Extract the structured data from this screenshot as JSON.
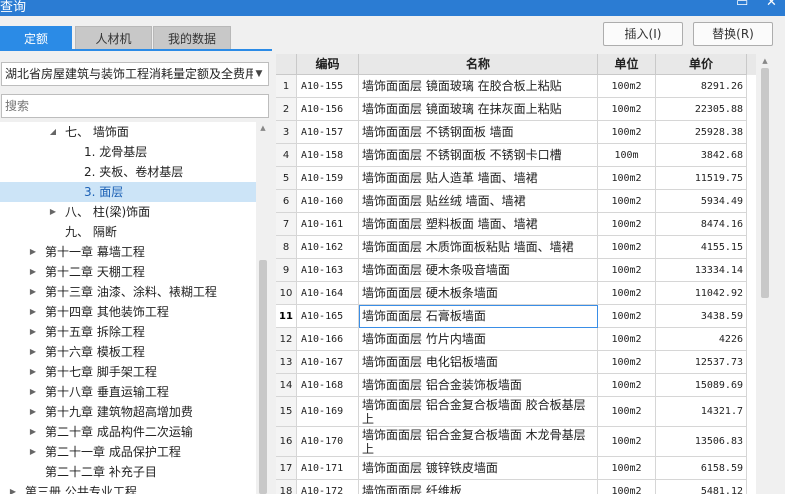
{
  "window": {
    "title": "查询",
    "close_glyph": "✕",
    "restore_glyph": "▭"
  },
  "tabs": [
    {
      "label": "定额",
      "active": true
    },
    {
      "label": "人材机",
      "active": false
    },
    {
      "label": "我的数据",
      "active": false
    }
  ],
  "buttons": {
    "insert": "插入(I)",
    "replace": "替换(R)"
  },
  "library_select": {
    "value": "湖北省房屋建筑与装饰工程消耗量定额及全费用"
  },
  "search": {
    "placeholder": "搜索"
  },
  "tree": [
    {
      "label": "七、 墙饰面",
      "expander": "expanded",
      "level": 2,
      "selected": false
    },
    {
      "label": "1. 龙骨基层",
      "expander": "none",
      "level": 3,
      "selected": false
    },
    {
      "label": "2. 夹板、卷材基层",
      "expander": "none",
      "level": 3,
      "selected": false
    },
    {
      "label": "3. 面层",
      "expander": "none",
      "level": 3,
      "selected": true
    },
    {
      "label": "八、 柱(梁)饰面",
      "expander": "collapsed",
      "level": 2,
      "selected": false
    },
    {
      "label": "九、 隔断",
      "expander": "none",
      "level": 2,
      "selected": false
    },
    {
      "label": "第十一章 幕墙工程",
      "expander": "collapsed",
      "level": 1,
      "selected": false
    },
    {
      "label": "第十二章 天棚工程",
      "expander": "collapsed",
      "level": 1,
      "selected": false
    },
    {
      "label": "第十三章 油漆、涂料、裱糊工程",
      "expander": "collapsed",
      "level": 1,
      "selected": false
    },
    {
      "label": "第十四章 其他装饰工程",
      "expander": "collapsed",
      "level": 1,
      "selected": false
    },
    {
      "label": "第十五章 拆除工程",
      "expander": "collapsed",
      "level": 1,
      "selected": false
    },
    {
      "label": "第十六章 模板工程",
      "expander": "collapsed",
      "level": 1,
      "selected": false
    },
    {
      "label": "第十七章 脚手架工程",
      "expander": "collapsed",
      "level": 1,
      "selected": false
    },
    {
      "label": "第十八章 垂直运输工程",
      "expander": "collapsed",
      "level": 1,
      "selected": false
    },
    {
      "label": "第十九章 建筑物超高增加费",
      "expander": "collapsed",
      "level": 1,
      "selected": false
    },
    {
      "label": "第二十章 成品构件二次运输",
      "expander": "collapsed",
      "level": 1,
      "selected": false
    },
    {
      "label": "第二十一章 成品保护工程",
      "expander": "collapsed",
      "level": 1,
      "selected": false
    },
    {
      "label": "第二十二章 补充子目",
      "expander": "none",
      "level": 1,
      "selected": false
    },
    {
      "label": "第三册 公共专业工程",
      "expander": "collapsed",
      "level": 0,
      "selected": false
    }
  ],
  "table": {
    "columns": [
      "编码",
      "名称",
      "单位",
      "单价"
    ],
    "rows": [
      {
        "num": "1",
        "code": "A10-155",
        "name": "墙饰面面层 镜面玻璃 在胶合板上粘贴",
        "unit": "100m2",
        "price": "8291.26"
      },
      {
        "num": "2",
        "code": "A10-156",
        "name": "墙饰面面层 镜面玻璃 在抹灰面上粘贴",
        "unit": "100m2",
        "price": "22305.88"
      },
      {
        "num": "3",
        "code": "A10-157",
        "name": "墙饰面面层 不锈钢面板 墙面",
        "unit": "100m2",
        "price": "25928.38"
      },
      {
        "num": "4",
        "code": "A10-158",
        "name": "墙饰面面层 不锈钢面板 不锈钢卡口槽",
        "unit": "100m",
        "price": "3842.68"
      },
      {
        "num": "5",
        "code": "A10-159",
        "name": "墙饰面面层 贴人造革 墙面、墙裙",
        "unit": "100m2",
        "price": "11519.75"
      },
      {
        "num": "6",
        "code": "A10-160",
        "name": "墙饰面面层 贴丝绒 墙面、墙裙",
        "unit": "100m2",
        "price": "5934.49"
      },
      {
        "num": "7",
        "code": "A10-161",
        "name": "墙饰面面层 塑料板面 墙面、墙裙",
        "unit": "100m2",
        "price": "8474.16"
      },
      {
        "num": "8",
        "code": "A10-162",
        "name": "墙饰面面层 木质饰面板粘贴 墙面、墙裙",
        "unit": "100m2",
        "price": "4155.15"
      },
      {
        "num": "9",
        "code": "A10-163",
        "name": "墙饰面面层 硬木条吸音墙面",
        "unit": "100m2",
        "price": "13334.14"
      },
      {
        "num": "10",
        "code": "A10-164",
        "name": "墙饰面面层 硬木板条墙面",
        "unit": "100m2",
        "price": "11042.92"
      },
      {
        "num": "11",
        "code": "A10-165",
        "name": "墙饰面面层 石膏板墙面",
        "unit": "100m2",
        "price": "3438.59",
        "current": true
      },
      {
        "num": "12",
        "code": "A10-166",
        "name": "墙饰面面层 竹片内墙面",
        "unit": "100m2",
        "price": "4226"
      },
      {
        "num": "13",
        "code": "A10-167",
        "name": "墙饰面面层 电化铝板墙面",
        "unit": "100m2",
        "price": "12537.73"
      },
      {
        "num": "14",
        "code": "A10-168",
        "name": "墙饰面面层 铝合金装饰板墙面",
        "unit": "100m2",
        "price": "15089.69"
      },
      {
        "num": "15",
        "code": "A10-169",
        "name": "墙饰面面层 铝合金复合板墙面 胶合板基层上",
        "unit": "100m2",
        "price": "14321.7",
        "tall": true
      },
      {
        "num": "16",
        "code": "A10-170",
        "name": "墙饰面面层 铝合金复合板墙面 木龙骨基层上",
        "unit": "100m2",
        "price": "13506.83",
        "tall": true
      },
      {
        "num": "17",
        "code": "A10-171",
        "name": "墙饰面面层 镀锌铁皮墙面",
        "unit": "100m2",
        "price": "6158.59"
      },
      {
        "num": "18",
        "code": "A10-172",
        "name": "墙饰面面层 纤维板",
        "unit": "100m2",
        "price": "5481.12"
      }
    ]
  }
}
